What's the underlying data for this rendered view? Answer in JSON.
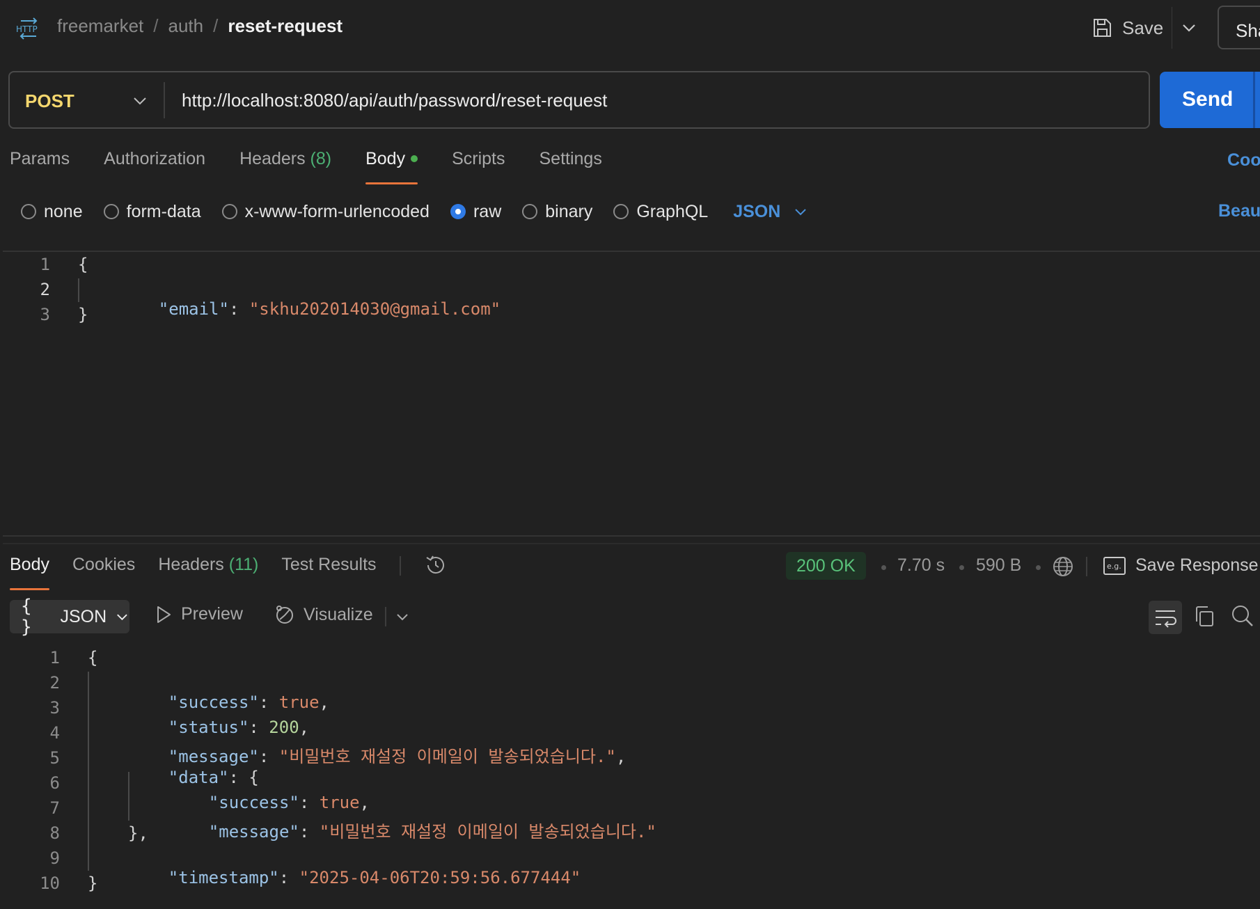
{
  "breadcrumb": {
    "collection": "freemarket",
    "folder": "auth",
    "request": "reset-request",
    "separator": "/"
  },
  "toolbar": {
    "save_label": "Save",
    "share_label": "Sha"
  },
  "request": {
    "method": "POST",
    "url": "http://localhost:8080/api/auth/password/reset-request",
    "send_label": "Send"
  },
  "request_tabs": {
    "params": "Params",
    "authorization": "Authorization",
    "headers": "Headers",
    "headers_count": "(8)",
    "body": "Body",
    "scripts": "Scripts",
    "settings": "Settings",
    "cookies": "Coo",
    "active": "Body"
  },
  "body_types": {
    "options": [
      "none",
      "form-data",
      "x-www-form-urlencoded",
      "raw",
      "binary",
      "GraphQL"
    ],
    "selected": "raw",
    "language": "JSON",
    "beautify": "Beaut"
  },
  "request_body": {
    "line_numbers": [
      "1",
      "2",
      "3"
    ],
    "open": "{",
    "key": "\"email\"",
    "colon": ": ",
    "value": "\"skhu202014030@gmail.com\"",
    "close": "}"
  },
  "response_tabs": {
    "body": "Body",
    "cookies": "Cookies",
    "headers": "Headers",
    "headers_count": "(11)",
    "test_results": "Test Results",
    "active": "Body"
  },
  "response_meta": {
    "status": "200 OK",
    "time": "7.70 s",
    "size": "590 B",
    "save_response": "Save Response",
    "status_color": "#59c27a"
  },
  "response_toolbar": {
    "format": "JSON",
    "braces": "{ }",
    "preview": "Preview",
    "visualize": "Visualize"
  },
  "response_body": {
    "line_numbers": [
      "1",
      "2",
      "3",
      "4",
      "5",
      "6",
      "7",
      "8",
      "9",
      "10"
    ],
    "open": "{",
    "success_key": "\"success\"",
    "success_value": "true",
    "status_key": "\"status\"",
    "status_value": "200",
    "message_key": "\"message\"",
    "message_value": "\"비밀번호 재설정 이메일이 발송되었습니다.\"",
    "data_key": "\"data\"",
    "data_open": "{",
    "data_success_key": "\"success\"",
    "data_success_value": "true",
    "data_message_key": "\"message\"",
    "data_message_value": "\"비밀번호 재설정 이메일이 발송되었습니다.\"",
    "data_close": "},",
    "timestamp_key": "\"timestamp\"",
    "timestamp_value": "\"2025-04-06T20:59:56.677444\"",
    "close": "}",
    "colon": ": ",
    "comma": ","
  },
  "colors": {
    "accent_blue": "#1e6ad6",
    "tab_underline": "#e8743b",
    "method": "#f5d76e"
  },
  "icons": [
    "http-icon",
    "save-icon",
    "chevron-down-icon",
    "history-icon",
    "globe-icon",
    "example-icon",
    "play-icon",
    "visualize-icon",
    "wrap-icon",
    "copy-icon",
    "search-icon"
  ]
}
